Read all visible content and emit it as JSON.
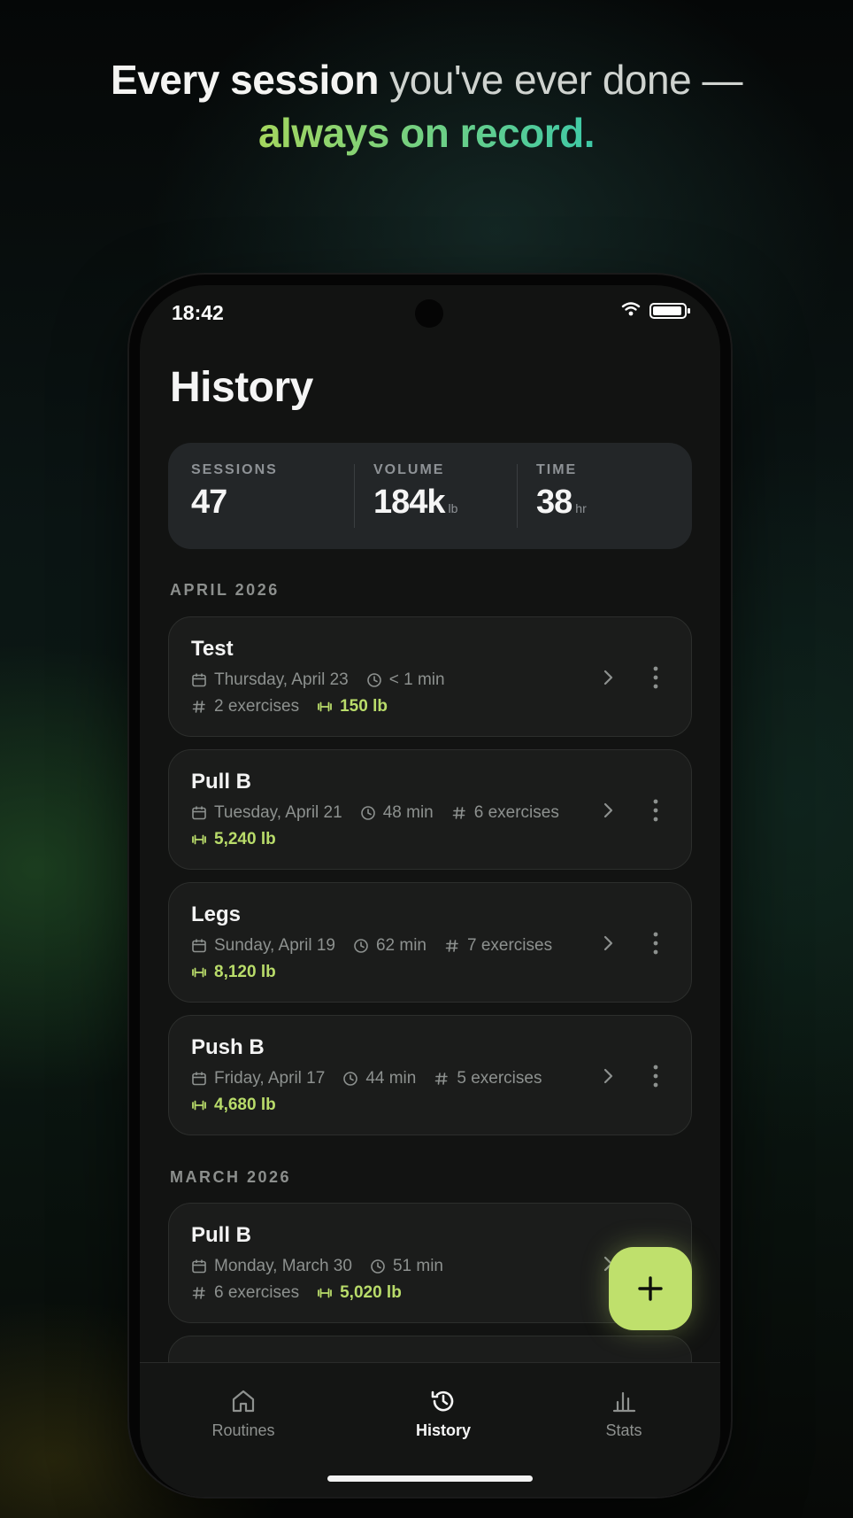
{
  "headline": {
    "bold": "Every session",
    "light": " you've ever done —",
    "accent": "always on record."
  },
  "status_bar": {
    "time": "18:42"
  },
  "page_title": "History",
  "stats": [
    {
      "label": "SESSIONS",
      "value": "47",
      "unit": ""
    },
    {
      "label": "VOLUME",
      "value": "184k",
      "unit": "lb"
    },
    {
      "label": "TIME",
      "value": "38",
      "unit": "hr"
    }
  ],
  "sections": [
    {
      "label": "APRIL 2026",
      "workouts": [
        {
          "name": "Test",
          "date": "Thursday, April 23",
          "duration": "< 1 min",
          "exercises": "2 exercises",
          "volume": "150 lb"
        },
        {
          "name": "Pull B",
          "date": "Tuesday, April 21",
          "duration": "48 min",
          "exercises": "6 exercises",
          "volume": "5,240 lb"
        },
        {
          "name": "Legs",
          "date": "Sunday, April 19",
          "duration": "62 min",
          "exercises": "7 exercises",
          "volume": "8,120 lb"
        },
        {
          "name": "Push B",
          "date": "Friday, April 17",
          "duration": "44 min",
          "exercises": "5 exercises",
          "volume": "4,680 lb"
        }
      ]
    },
    {
      "label": "MARCH 2026",
      "workouts": [
        {
          "name": "Pull B",
          "date": "Monday, March 30",
          "duration": "51 min",
          "exercises": "6 exercises",
          "volume": "5,020 lb"
        }
      ]
    }
  ],
  "fab": {
    "icon": "plus-icon"
  },
  "nav": [
    {
      "label": "Routines",
      "icon": "home-icon",
      "active": false
    },
    {
      "label": "History",
      "icon": "history-icon",
      "active": true
    },
    {
      "label": "Stats",
      "icon": "bar-chart-icon",
      "active": false
    }
  ],
  "colors": {
    "accent": "#bfe06c",
    "volume": "#b9dc6a",
    "card": "#1b1c1b",
    "screen": "#121312"
  }
}
